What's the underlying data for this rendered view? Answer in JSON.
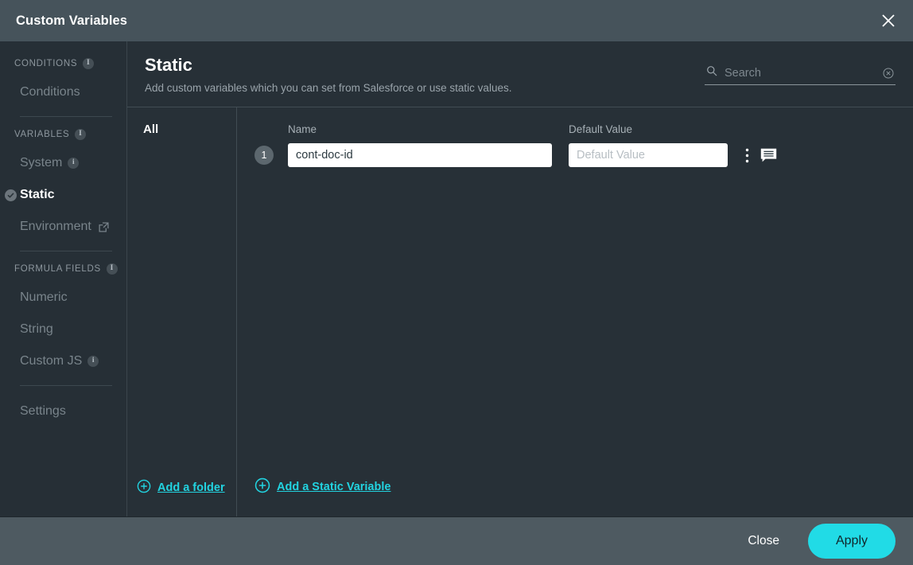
{
  "window": {
    "title": "Custom Variables",
    "close_icon": "close-icon"
  },
  "sidebar": {
    "groups": [
      {
        "label": "CONDITIONS",
        "has_info": true,
        "items": [
          {
            "label": "Conditions",
            "active": false,
            "has_info": false,
            "external": false
          }
        ]
      },
      {
        "label": "VARIABLES",
        "has_info": true,
        "items": [
          {
            "label": "System",
            "active": false,
            "has_info": true,
            "external": false
          },
          {
            "label": "Static",
            "active": true,
            "has_info": false,
            "external": false
          },
          {
            "label": "Environment",
            "active": false,
            "has_info": false,
            "external": true
          }
        ]
      },
      {
        "label": "FORMULA FIELDS",
        "has_info": true,
        "items": [
          {
            "label": "Numeric",
            "active": false,
            "has_info": false,
            "external": false
          },
          {
            "label": "String",
            "active": false,
            "has_info": false,
            "external": false
          },
          {
            "label": "Custom JS",
            "active": false,
            "has_info": true,
            "external": false
          }
        ]
      }
    ],
    "settings_label": "Settings"
  },
  "main": {
    "title": "Static",
    "subtitle": "Add custom variables which you can set from Salesforce or use static values.",
    "search": {
      "placeholder": "Search",
      "value": "",
      "search_icon": "search-icon",
      "clear_icon": "clear-circle-icon"
    }
  },
  "folders": {
    "items": [
      {
        "label": "All",
        "selected": true
      }
    ],
    "add_folder_label": "Add a folder"
  },
  "table": {
    "headers": {
      "name": "Name",
      "default_value": "Default Value"
    },
    "rows": [
      {
        "number": "1",
        "name": "cont-doc-id",
        "default_value": "",
        "default_value_placeholder": "Default Value",
        "menu_icon": "kebab-menu-icon",
        "comment_icon": "comment-icon"
      }
    ],
    "add_variable_label": "Add a Static Variable"
  },
  "footer": {
    "close_label": "Close",
    "apply_label": "Apply"
  },
  "colors": {
    "accent": "#21dbe6",
    "titlebar": "#46535b",
    "body": "#273037",
    "footer": "#4e5a61"
  }
}
